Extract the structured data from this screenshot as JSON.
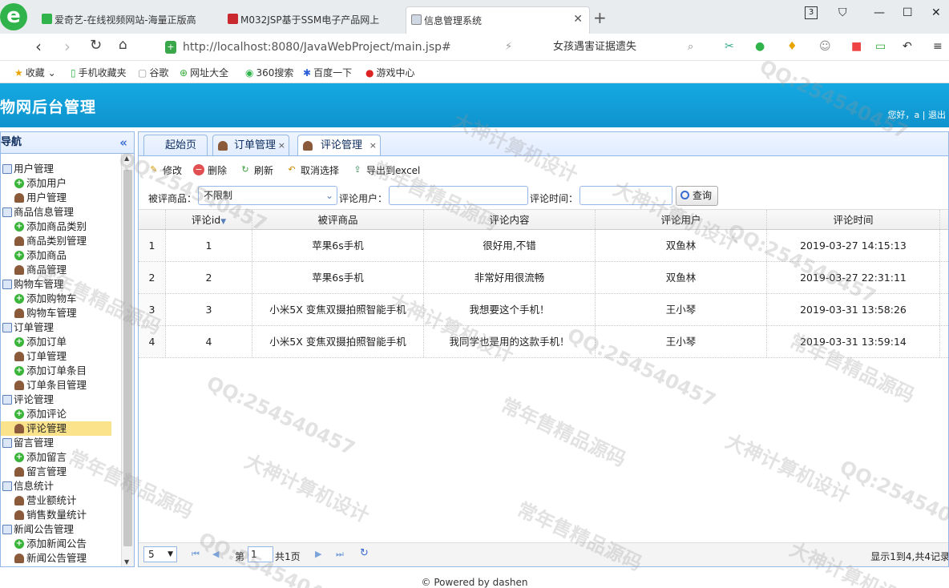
{
  "browser": {
    "tabs": [
      {
        "label": "爱奇艺-在线视频网站-海量正版高"
      },
      {
        "label": "M032JSP基于SSM电子产品网上"
      },
      {
        "label": "信息管理系统"
      }
    ],
    "new_tab": "+",
    "url": "http://localhost:8080/JavaWebProject/main.jsp#",
    "url_host": "localhost",
    "search_text": "女孩遇害证据遗失",
    "tab_count": "3",
    "bookmarks": [
      "收藏",
      "手机收藏夹",
      "谷歌",
      "网址大全",
      "360搜索",
      "百度一下",
      "游戏中心"
    ]
  },
  "app": {
    "title": "物网后台管理",
    "welcome": "您好，a | 退出"
  },
  "sidebar": {
    "title": "导航",
    "collapse": "«",
    "groups": [
      {
        "label": "用户管理",
        "items": [
          "添加用户",
          "用户管理"
        ]
      },
      {
        "label": "商品信息管理",
        "items": [
          "添加商品类别",
          "商品类别管理",
          "添加商品",
          "商品管理"
        ]
      },
      {
        "label": "购物车管理",
        "items": [
          "添加购物车",
          "购物车管理"
        ]
      },
      {
        "label": "订单管理",
        "items": [
          "添加订单",
          "订单管理",
          "添加订单条目",
          "订单条目管理"
        ]
      },
      {
        "label": "评论管理",
        "items": [
          "添加评论",
          "评论管理"
        ]
      },
      {
        "label": "留言管理",
        "items": [
          "添加留言",
          "留言管理"
        ]
      },
      {
        "label": "信息统计",
        "items": [
          "营业额统计",
          "销售数量统计"
        ]
      },
      {
        "label": "新闻公告管理",
        "items": [
          "添加新闻公告",
          "新闻公告管理"
        ]
      }
    ],
    "selected": "评论管理"
  },
  "content_tabs": [
    {
      "label": "起始页"
    },
    {
      "label": "订单管理",
      "close": "×"
    },
    {
      "label": "评论管理",
      "close": "×"
    }
  ],
  "toolbar": {
    "edit": "修改",
    "delete": "删除",
    "refresh": "刷新",
    "cancel_select": "取消选择",
    "export": "导出到excel"
  },
  "filters": {
    "product_label": "被评商品：",
    "product_value": "不限制",
    "user_label": "评论用户：",
    "user_value": "",
    "time_label": "评论时间：",
    "time_value": "",
    "query": "查询"
  },
  "grid": {
    "columns": [
      "评论id",
      "被评商品",
      "评论内容",
      "评论用户",
      "评论时间"
    ],
    "sort_indicator": "▼",
    "rows": [
      {
        "n": "1",
        "id": "1",
        "product": "苹果6s手机",
        "content": "很好用,不错",
        "user": "双鱼林",
        "time": "2019-03-27 14:15:13"
      },
      {
        "n": "2",
        "id": "2",
        "product": "苹果6s手机",
        "content": "非常好用很流畅",
        "user": "双鱼林",
        "time": "2019-03-27 22:31:11"
      },
      {
        "n": "3",
        "id": "3",
        "product": "小米5X 变焦双摄拍照智能手机",
        "content": "我想要这个手机！",
        "user": "王小琴",
        "time": "2019-03-31 13:58:26"
      },
      {
        "n": "4",
        "id": "4",
        "product": "小米5X 变焦双摄拍照智能手机",
        "content": "我同学也是用的这款手机！",
        "user": "王小琴",
        "time": "2019-03-31 13:59:14"
      }
    ]
  },
  "pager": {
    "page_size": "5",
    "page_prefix": "第",
    "page": "1",
    "page_suffix": "共1页",
    "info": "显示1到4,共4记录"
  },
  "footer": "© Powered by dashen",
  "watermarks": [
    "QQ:254540457",
    "大神计算机设计",
    "常年售精品源码"
  ],
  "colors": {
    "header": "#0e93cd",
    "selected": "#fbe38c",
    "border": "#95b8e7"
  }
}
